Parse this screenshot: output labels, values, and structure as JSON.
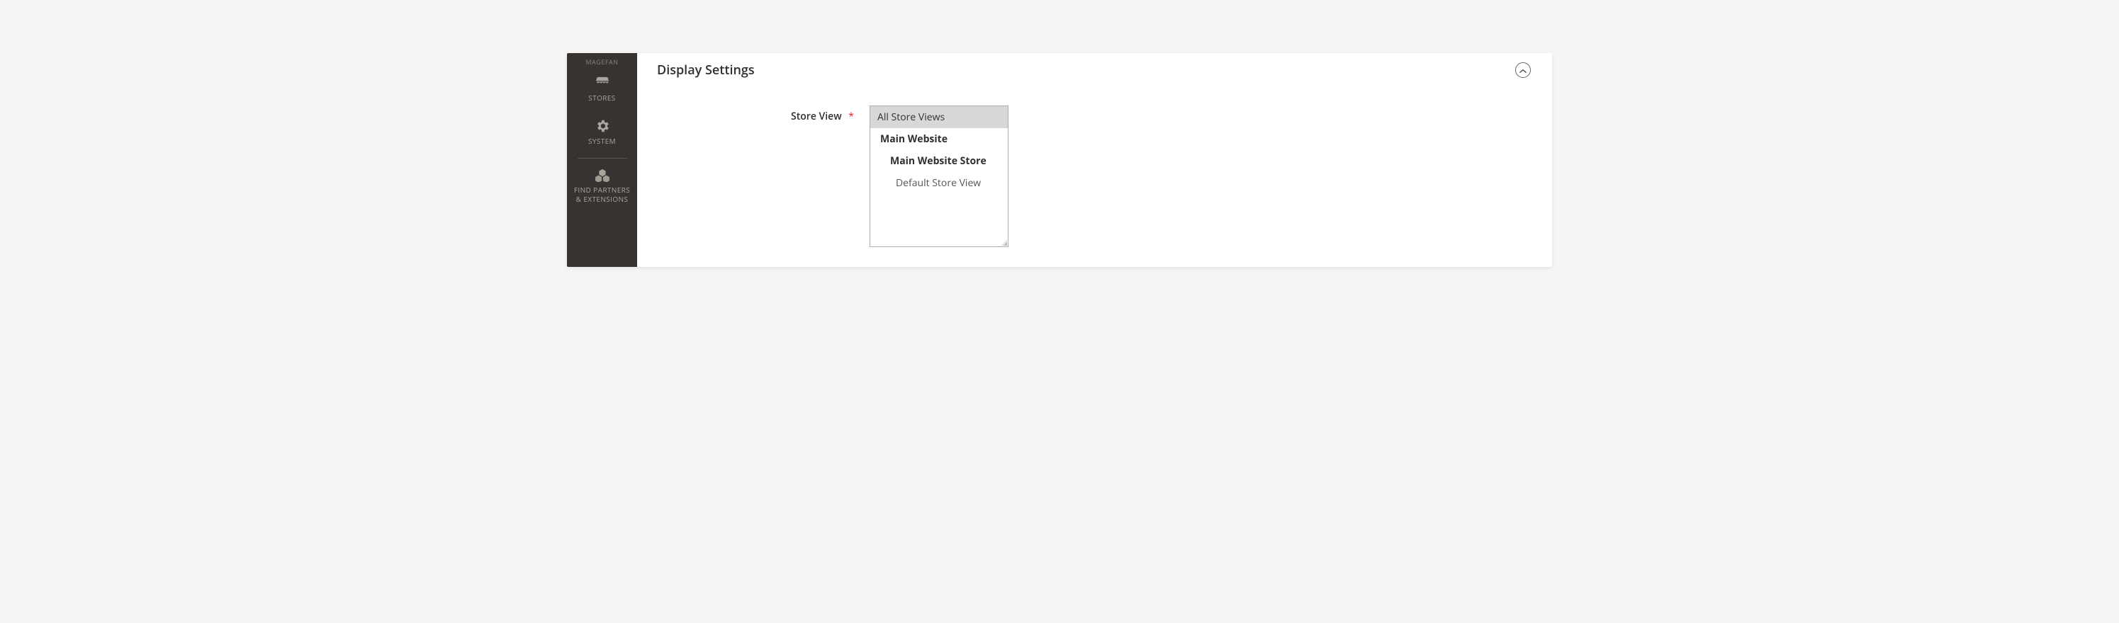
{
  "sidebar": {
    "topLabel": "MAGEFAN",
    "items": [
      {
        "label": "STORES",
        "icon": "stores-icon"
      },
      {
        "label": "SYSTEM",
        "icon": "system-icon"
      }
    ],
    "footerItem": {
      "label": "FIND PARTNERS\n& EXTENSIONS",
      "icon": "partners-icon"
    }
  },
  "section": {
    "title": "Display Settings"
  },
  "form": {
    "storeView": {
      "label": "Store View",
      "required": true,
      "options": [
        {
          "label": "All Store Views",
          "level": "top",
          "selected": true
        },
        {
          "label": "Main Website",
          "level": 0,
          "selected": false
        },
        {
          "label": "Main Website Store",
          "level": 1,
          "selected": false
        },
        {
          "label": "Default Store View",
          "level": 2,
          "selected": false
        }
      ]
    }
  }
}
